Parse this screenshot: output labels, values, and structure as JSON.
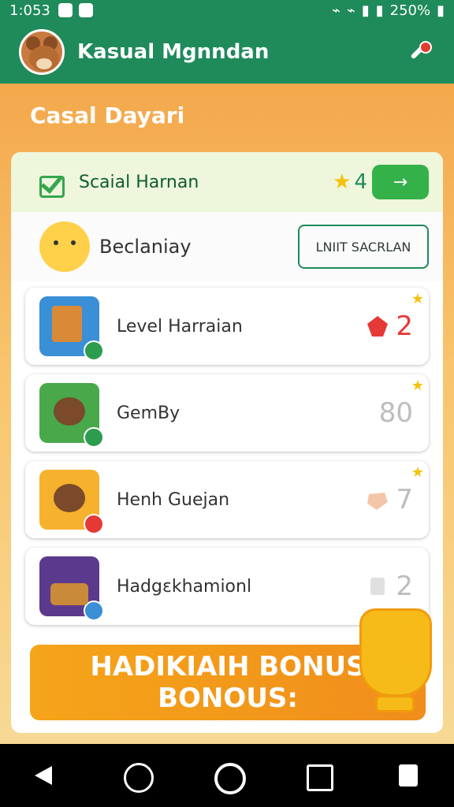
{
  "status": {
    "time": "1:053",
    "battery": "250%"
  },
  "app": {
    "title": "Kasual Mgnndan",
    "section_title": "Casal Dayari"
  },
  "card": {
    "title": "Scaial Harnan",
    "stars": "4",
    "go_label": "→"
  },
  "user": {
    "name": "Beclaniay",
    "action_label": "LNIIT SACRLAN"
  },
  "items": [
    {
      "label": "Level Harraian",
      "value": "2",
      "icon": "book-icon",
      "value_icon": "ruby-icon"
    },
    {
      "label": "GemBy",
      "value": "80",
      "icon": "bear-icon",
      "value_icon": ""
    },
    {
      "label": "Henh Guejan",
      "value": "7",
      "icon": "bear-icon",
      "value_icon": "coral-gem-icon"
    },
    {
      "label": "Hadgɛkhamionl",
      "value": "2",
      "icon": "basket-icon",
      "value_icon": "paper-icon"
    }
  ],
  "banner": {
    "line1": "HADIKIAIH BONUS",
    "line2": "BONOUS:"
  },
  "colors": {
    "primary": "#1f8a5a",
    "accent": "#f5a519",
    "star": "#f4c20d",
    "ruby": "#e53935"
  }
}
